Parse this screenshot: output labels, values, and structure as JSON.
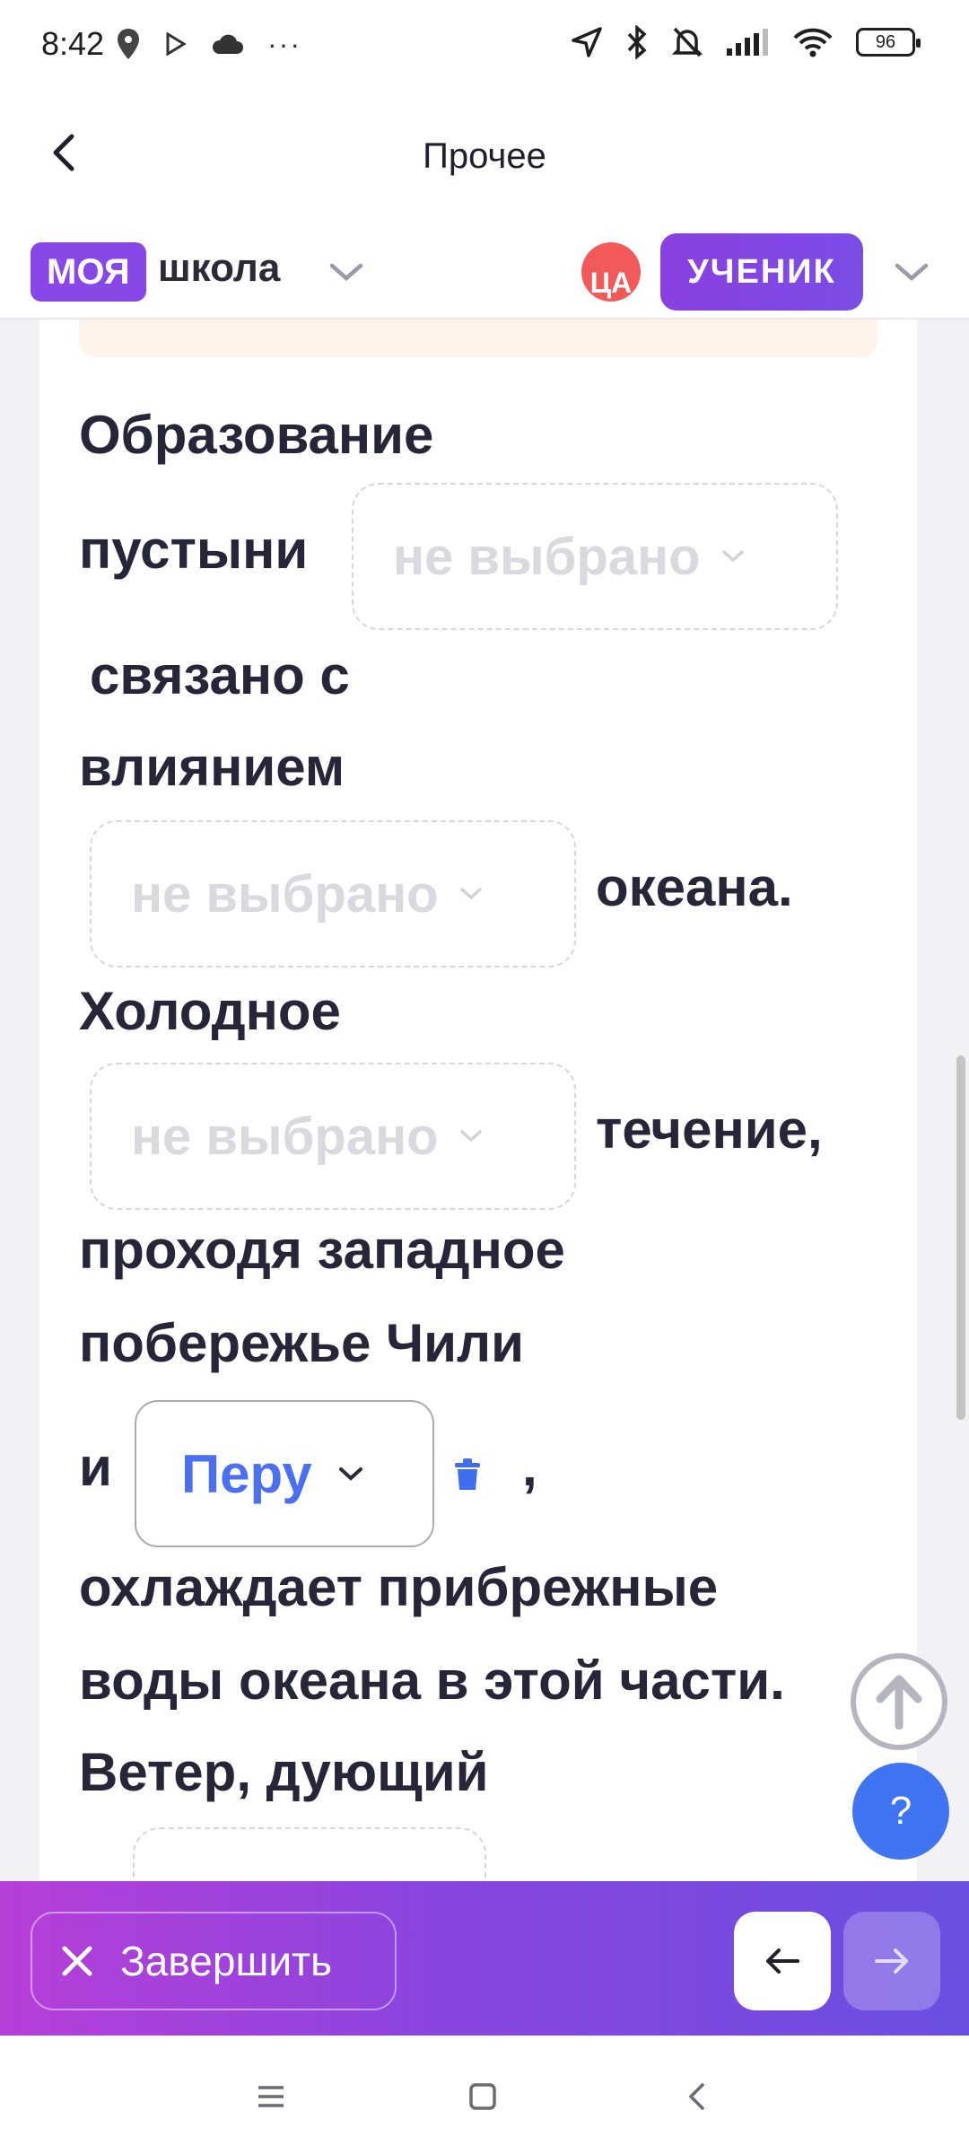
{
  "status_bar": {
    "time": "8:42",
    "more": "···",
    "battery": "96"
  },
  "header": {
    "title": "Прочее"
  },
  "school_bar": {
    "logo_chip": "МОЯ",
    "logo_text": "школа",
    "avatar_initials": "ЦА",
    "role": "УЧЕНИК"
  },
  "task": {
    "w1": "Образование",
    "w2": "пустыни",
    "w3": "связано с",
    "w4": "влиянием",
    "w5": "океана.",
    "w6": "Холодное",
    "w7": "течение,",
    "w8": "проходя западное",
    "w9": "побережье Чили",
    "w10": "и",
    "w11": ",",
    "w12": "охлаждает прибрежные",
    "w13": "воды океана в этой части.",
    "w14": "Ветер, дующий",
    "dropdown1": "не выбрано",
    "dropdown2": "не выбрано",
    "dropdown3": "не выбрано",
    "dropdown_selected": "Перу"
  },
  "help_button": "?",
  "action_bar": {
    "finish_label": "Завершить"
  }
}
